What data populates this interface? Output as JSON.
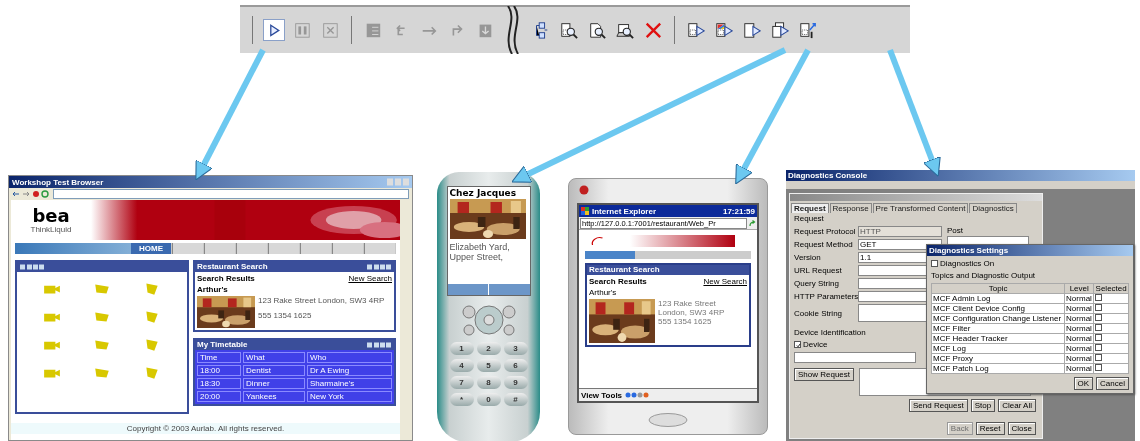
{
  "toolbar": {
    "items": [
      {
        "kind": "separator"
      },
      {
        "kind": "run",
        "disabled": false,
        "pressed": true
      },
      {
        "kind": "pause",
        "disabled": true,
        "pressed": false
      },
      {
        "kind": "stop",
        "disabled": true,
        "pressed": false
      },
      {
        "kind": "separator"
      },
      {
        "kind": "list",
        "disabled": true,
        "pressed": false
      },
      {
        "kind": "step-into",
        "disabled": true,
        "pressed": false
      },
      {
        "kind": "step-over",
        "disabled": true,
        "pressed": false
      },
      {
        "kind": "step-return",
        "disabled": true,
        "pressed": false
      },
      {
        "kind": "drop",
        "disabled": true,
        "pressed": false
      },
      {
        "kind": "break"
      },
      {
        "kind": "tree",
        "disabled": false,
        "pressed": false
      },
      {
        "kind": "device-search",
        "disabled": false,
        "pressed": false
      },
      {
        "kind": "page-search",
        "disabled": false,
        "pressed": false
      },
      {
        "kind": "laptop-search",
        "disabled": false,
        "pressed": false
      },
      {
        "kind": "delete",
        "disabled": false,
        "pressed": false
      },
      {
        "kind": "separator"
      },
      {
        "kind": "phone-run",
        "disabled": false,
        "pressed": false
      },
      {
        "kind": "color-phone-run",
        "disabled": false,
        "pressed": false
      },
      {
        "kind": "pda-run",
        "disabled": false,
        "pressed": false
      },
      {
        "kind": "multi-run",
        "disabled": false,
        "pressed": false
      },
      {
        "kind": "device-config",
        "disabled": false,
        "pressed": false
      }
    ]
  },
  "browser": {
    "title": "Workshop Test Browser",
    "logo": "bea",
    "tagline": "ThinkLiquid",
    "nav_tabs": [
      {
        "label": "HOME",
        "selected": true
      },
      {
        "selected": false
      },
      {
        "selected": false
      },
      {
        "selected": false
      },
      {
        "selected": false
      },
      {
        "selected": false
      },
      {
        "selected": false
      },
      {
        "selected": false
      }
    ],
    "restaurant_portlet": {
      "title": "Restaurant Search",
      "results": "Search Results",
      "new_search": "New Search",
      "name": "Arthur's",
      "address": "123 Rake Street London, SW3 4RP",
      "phone": "555 1354 1625"
    },
    "timetable": {
      "title": "My Timetable",
      "columns": [
        "Time",
        "What",
        "Who"
      ],
      "rows": [
        [
          "18:00",
          "Dentist",
          "Dr A Ewing"
        ],
        [
          "18:30",
          "Dinner",
          "Sharmaine's"
        ],
        [
          "20:00",
          "Yankees",
          "New York"
        ]
      ]
    },
    "footer": "Copyright © 2003 Aurlab. All rights reserved."
  },
  "phone": {
    "heading": "Chez Jacques",
    "address": [
      "Elizabeth Yard,",
      "Upper Street,"
    ],
    "keys": [
      "1",
      "2",
      "3",
      "4",
      "5",
      "6",
      "7",
      "8",
      "9",
      "*",
      "0",
      "#"
    ]
  },
  "pda": {
    "title": "Internet Explorer",
    "time": "17:21:59",
    "address": "http://127.0.0.1:7001/restaurant/Web_Pr",
    "portlet": {
      "title": "Restaurant Search",
      "results": "Search Results",
      "new_search": "New Search",
      "name": "Arthur's",
      "address": [
        "123 Rake Street",
        "London, SW3 4RP",
        "555 1354 1625"
      ]
    },
    "menu": "View Tools"
  },
  "console": {
    "title": "Diagnostics Console",
    "tabs": [
      {
        "label": "Request",
        "selected": true
      },
      {
        "label": "Response",
        "selected": false
      },
      {
        "label": "Pre Transformed Content",
        "selected": false
      },
      {
        "label": "Diagnostics",
        "selected": false
      }
    ],
    "section": "Request",
    "fields": [
      {
        "label": "Request Protocol",
        "kind": "combo",
        "value": "HTTP",
        "disabled": true
      },
      {
        "label": "Request Method",
        "kind": "combo",
        "value": "GET",
        "disabled": false
      },
      {
        "label": "Version",
        "kind": "combo",
        "value": "1.1",
        "disabled": false
      },
      {
        "label": "URL Request",
        "kind": "text"
      },
      {
        "label": "Query String",
        "kind": "text"
      },
      {
        "label": "HTTP Parameters",
        "kind": "text"
      },
      {
        "label": "Cookie String",
        "kind": "area"
      }
    ],
    "post_label": "Post",
    "device_section": "Device Identification",
    "device_option": {
      "label": "Device",
      "checked": true
    },
    "show_request": "Show Request",
    "buttons": [
      {
        "label": "Send Request",
        "disabled": false
      },
      {
        "label": "Stop",
        "disabled": false
      },
      {
        "label": "Clear All",
        "disabled": false
      }
    ],
    "footer_buttons": [
      {
        "label": "Back",
        "disabled": true
      },
      {
        "label": "Reset",
        "disabled": false
      },
      {
        "label": "Close",
        "disabled": false
      }
    ],
    "dialog": {
      "title": "Diagnostics Settings",
      "toggle": {
        "label": "Diagnostics On",
        "checked": false
      },
      "group": "Topics and Diagnostic Output",
      "columns": [
        "Topic",
        "Level",
        "Selected"
      ],
      "rows": [
        {
          "topic": "MCF Admin Log",
          "level": "Normal",
          "selected": false
        },
        {
          "topic": "MCF Client Device Config",
          "level": "Normal",
          "selected": false
        },
        {
          "topic": "MCF Configuration Change Listener",
          "level": "Normal",
          "selected": false
        },
        {
          "topic": "MCF Filter",
          "level": "Normal",
          "selected": false
        },
        {
          "topic": "MCF Header Tracker",
          "level": "Normal",
          "selected": false
        },
        {
          "topic": "MCF Log",
          "level": "Normal",
          "selected": false
        },
        {
          "topic": "MCF Proxy",
          "level": "Normal",
          "selected": false
        },
        {
          "topic": "MCF Patch Log",
          "level": "Normal",
          "selected": false
        }
      ],
      "buttons": [
        "OK",
        "Cancel"
      ]
    }
  }
}
